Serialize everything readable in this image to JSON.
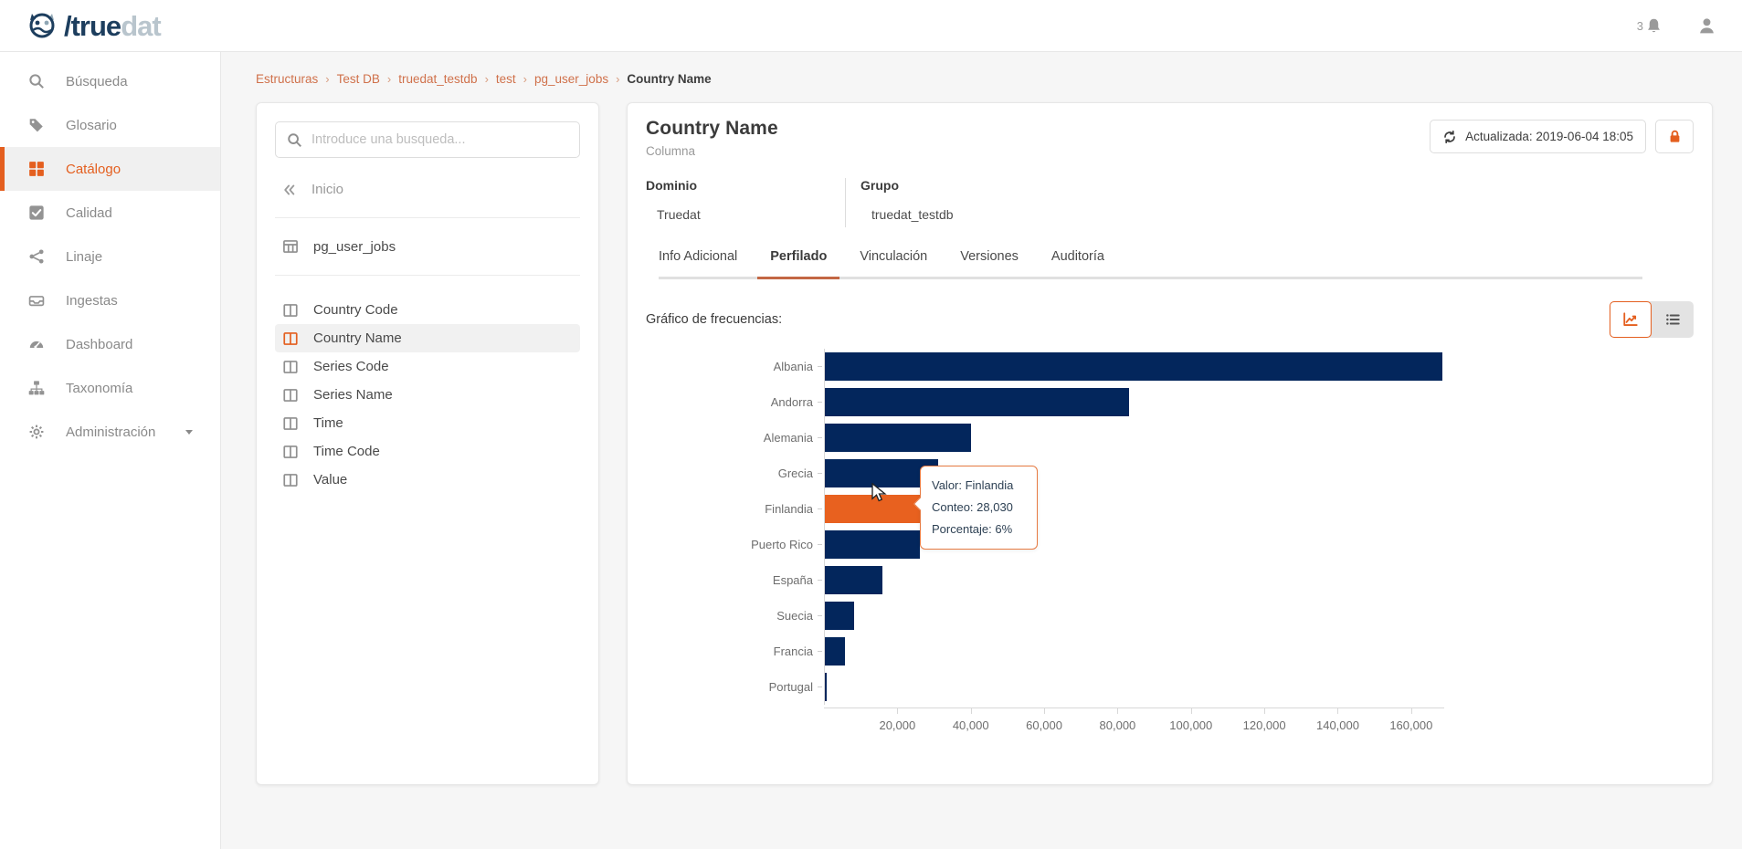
{
  "topbar": {
    "brand_dark": "/true",
    "brand_light": "dat",
    "notification_count": "3"
  },
  "sidebar": {
    "items": [
      {
        "icon": "search-icon",
        "label": "Búsqueda"
      },
      {
        "icon": "tags-icon",
        "label": "Glosario"
      },
      {
        "icon": "grid-icon",
        "label": "Catálogo",
        "active": true
      },
      {
        "icon": "check-square-icon",
        "label": "Calidad"
      },
      {
        "icon": "share-icon",
        "label": "Linaje"
      },
      {
        "icon": "inbox-icon",
        "label": "Ingestas"
      },
      {
        "icon": "gauge-icon",
        "label": "Dashboard"
      },
      {
        "icon": "sitemap-icon",
        "label": "Taxonomía"
      },
      {
        "icon": "gear-icon",
        "label": "Administración",
        "caret": true
      }
    ]
  },
  "breadcrumb": {
    "separator": "›",
    "items": [
      "Estructuras",
      "Test DB",
      "truedat_testdb",
      "test",
      "pg_user_jobs",
      "Country Name"
    ]
  },
  "left_panel": {
    "search_placeholder": "Introduce una busqueda...",
    "back_label": "Inicio",
    "table_name": "pg_user_jobs",
    "columns": [
      {
        "name": "Country Code"
      },
      {
        "name": "Country Name",
        "selected": true
      },
      {
        "name": "Series Code"
      },
      {
        "name": "Series Name"
      },
      {
        "name": "Time"
      },
      {
        "name": "Time Code"
      },
      {
        "name": "Value"
      }
    ]
  },
  "detail": {
    "title": "Country Name",
    "subtitle": "Columna",
    "updated_label": "Actualizada: 2019-06-04 18:05",
    "meta": [
      {
        "label": "Dominio",
        "value": "Truedat"
      },
      {
        "label": "Grupo",
        "value": "truedat_testdb"
      }
    ],
    "section_label": "Gráfico de frecuencias:"
  },
  "tabs": {
    "items": [
      {
        "label": "Info Adicional"
      },
      {
        "label": "Perfilado",
        "active": true
      },
      {
        "label": "Vinculación"
      },
      {
        "label": "Versiones"
      },
      {
        "label": "Auditoría"
      }
    ]
  },
  "chart_data": {
    "type": "bar",
    "orientation": "horizontal",
    "title": "Gráfico de frecuencias",
    "categories": [
      "Albania",
      "Andorra",
      "Alemania",
      "Grecia",
      "Finlandia",
      "Puerto Rico",
      "España",
      "Suecia",
      "Francia",
      "Portugal"
    ],
    "values": [
      168500,
      83000,
      40000,
      31000,
      28030,
      25800,
      15600,
      8100,
      5500,
      600
    ],
    "highlighted_category": "Finlandia",
    "highlight_value": 28030,
    "highlight_percentage": "6%",
    "bar_color": "#03265c",
    "highlight_color": "#e8611f",
    "xlim": [
      0,
      169000
    ],
    "x_ticks": [
      20000,
      40000,
      60000,
      80000,
      100000,
      120000,
      140000,
      160000
    ],
    "x_tick_labels": [
      "20,000",
      "40,000",
      "60,000",
      "80,000",
      "100,000",
      "120,000",
      "140,000",
      "160,000"
    ],
    "grid": false,
    "legend": false,
    "tooltip": {
      "lines": [
        "Valor: Finlandia",
        "Conteo: 28,030",
        "Porcentaje: 6%"
      ]
    }
  }
}
